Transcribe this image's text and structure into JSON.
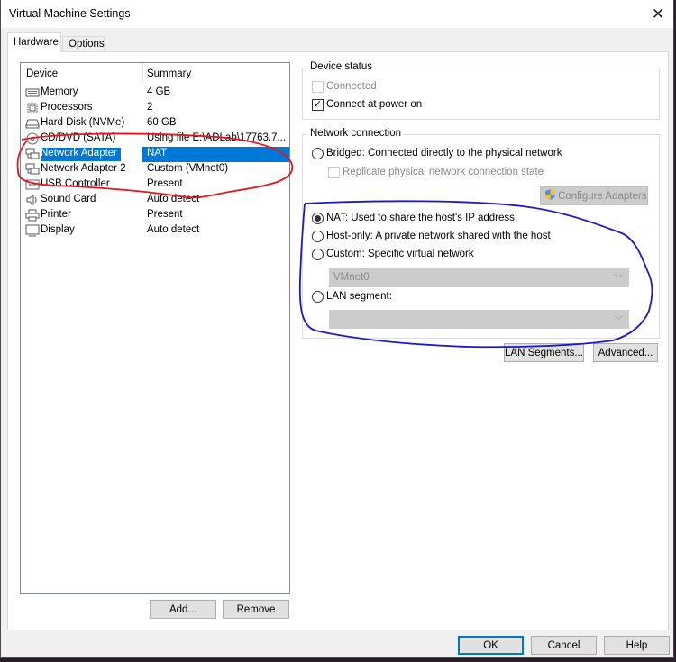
{
  "window": {
    "title": "Virtual Machine Settings",
    "close_icon": "close-icon"
  },
  "tabs": [
    {
      "label": "Hardware",
      "active": true
    },
    {
      "label": "Options",
      "active": false
    }
  ],
  "device_list": {
    "columns": [
      "Device",
      "Summary"
    ],
    "rows": [
      {
        "icon": "memory-icon",
        "device": "Memory",
        "summary": "4 GB",
        "selected": false
      },
      {
        "icon": "processor-icon",
        "device": "Processors",
        "summary": "2",
        "selected": false
      },
      {
        "icon": "hard-disk-icon",
        "device": "Hard Disk (NVMe)",
        "summary": "60 GB",
        "selected": false
      },
      {
        "icon": "cd-dvd-icon",
        "device": "CD/DVD (SATA)",
        "summary": "Using file E:\\ADLab\\17763.7...",
        "selected": false
      },
      {
        "icon": "network-adapter-icon",
        "device": "Network Adapter",
        "summary": "NAT",
        "selected": true
      },
      {
        "icon": "network-adapter-icon",
        "device": "Network Adapter 2",
        "summary": "Custom (VMnet0)",
        "selected": false
      },
      {
        "icon": "usb-controller-icon",
        "device": "USB Controller",
        "summary": "Present",
        "selected": false
      },
      {
        "icon": "sound-card-icon",
        "device": "Sound Card",
        "summary": "Auto detect",
        "selected": false
      },
      {
        "icon": "printer-icon",
        "device": "Printer",
        "summary": "Present",
        "selected": false
      },
      {
        "icon": "display-icon",
        "device": "Display",
        "summary": "Auto detect",
        "selected": false
      }
    ],
    "add_label": "Add...",
    "remove_label": "Remove"
  },
  "device_status": {
    "title": "Device status",
    "connected": {
      "label": "Connected",
      "checked": false,
      "enabled": false
    },
    "connect_at_power_on": {
      "label": "Connect at power on",
      "checked": true,
      "enabled": true
    }
  },
  "network_connection": {
    "title": "Network connection",
    "bridged": {
      "label": "Bridged: Connected directly to the physical network",
      "selected": false
    },
    "replicate": {
      "label": "Replicate physical network connection state",
      "checked": false,
      "enabled": false
    },
    "configure_adapters_label": "Configure Adapters",
    "nat": {
      "label": "NAT: Used to share the host's IP address",
      "selected": true
    },
    "host_only": {
      "label": "Host-only: A private network shared with the host",
      "selected": false
    },
    "custom": {
      "label": "Custom: Specific virtual network",
      "selected": false
    },
    "custom_select_value": "VMnet0",
    "lan_segment": {
      "label": "LAN segment:",
      "selected": false
    },
    "lan_segment_select_value": "",
    "lan_segments_button": "LAN Segments...",
    "advanced_button": "Advanced..."
  },
  "footer": {
    "ok_label": "OK",
    "cancel_label": "Cancel",
    "help_label": "Help"
  },
  "annotations": {
    "red_outline_color": "#e8141c",
    "blue_outline_color": "#1a1ac8"
  }
}
